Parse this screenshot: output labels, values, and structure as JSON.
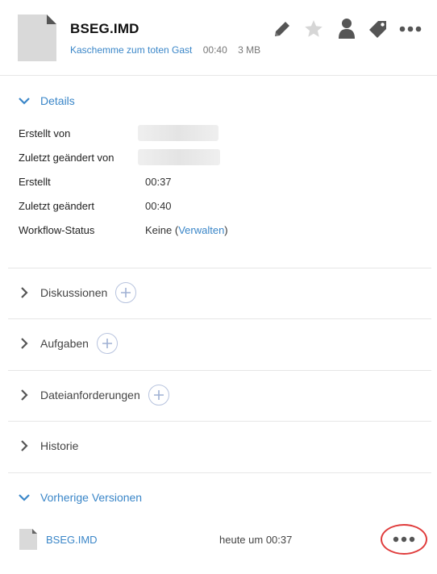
{
  "header": {
    "file_name": "BSEG.IMD",
    "folder": "Kaschemme zum toten Gast",
    "time": "00:40",
    "size": "3 MB",
    "icons": [
      "pencil-icon",
      "star-icon",
      "person-icon",
      "tag-icon",
      "more-icon"
    ]
  },
  "details": {
    "title": "Details",
    "rows": {
      "created_by": {
        "label": "Erstellt von",
        "value": ""
      },
      "modified_by": {
        "label": "Zuletzt geändert von",
        "value": ""
      },
      "created": {
        "label": "Erstellt",
        "value": "00:37"
      },
      "modified": {
        "label": "Zuletzt geändert",
        "value": "00:40"
      },
      "workflow": {
        "label": "Workflow-Status",
        "value": "Keine (",
        "link": "Verwalten",
        "suffix": ")"
      }
    }
  },
  "sections": {
    "discussions": "Diskussionen",
    "tasks": "Aufgaben",
    "file_requests": "Dateianforderungen",
    "history": "Historie",
    "versions": "Vorherige Versionen"
  },
  "versions": [
    {
      "name": "BSEG.IMD",
      "date": "heute um 00:37"
    }
  ],
  "colors": {
    "accent": "#3a86c8",
    "highlight": "#e03c3c",
    "icon": "#555555",
    "star": "#d6d6d6"
  }
}
